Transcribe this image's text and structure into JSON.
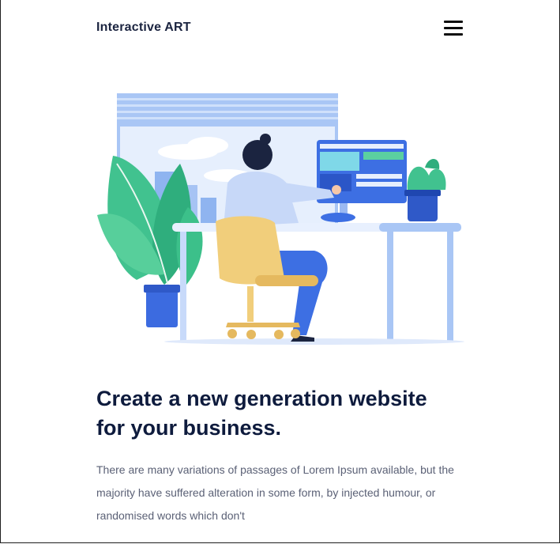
{
  "header": {
    "brand": "Interactive ART",
    "menu_icon": "hamburger-menu-icon"
  },
  "illustration": {
    "subject": "person-working-at-desk-illustration"
  },
  "hero": {
    "title_line1": "Create a new generation website",
    "title_line2": "for your business.",
    "description": "There are many variations of passages of Lorem Ipsum available, but the majority have suffered alteration in some form, by injected humour, or randomised words which don't"
  },
  "colors": {
    "primary": "#0e1b3d",
    "text_muted": "#5b6176",
    "accent_blue": "#3d6fe3",
    "accent_green": "#3fbf8c",
    "chair_yellow": "#f1ce7b"
  }
}
